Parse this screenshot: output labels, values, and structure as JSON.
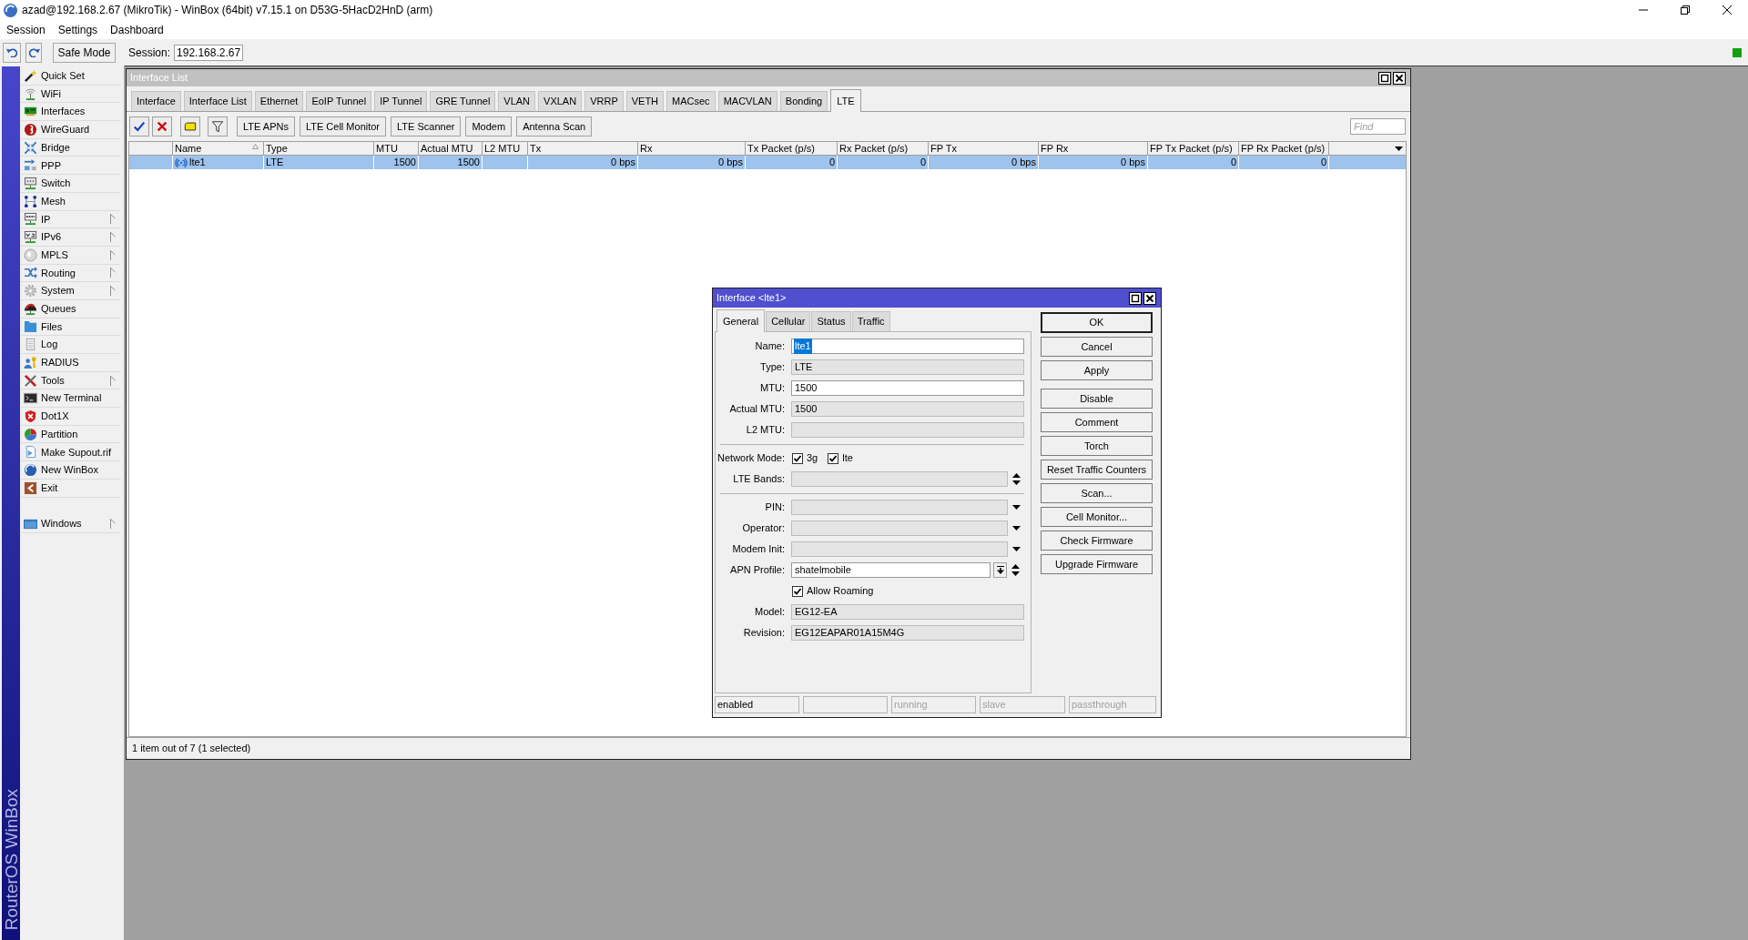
{
  "window": {
    "title": "azad@192.168.2.67 (MikroTik) - WinBox (64bit) v7.15.1 on D53G-5HacD2HnD (arm)"
  },
  "menu": [
    "Session",
    "Settings",
    "Dashboard"
  ],
  "toolbar": {
    "safe_mode": "Safe Mode",
    "session_label": "Session:",
    "session_value": "192.168.2.67"
  },
  "sidebar": {
    "brand": "RouterOS WinBox",
    "items": [
      {
        "label": "Quick Set",
        "submenu": false
      },
      {
        "label": "WiFi",
        "submenu": false
      },
      {
        "label": "Interfaces",
        "submenu": false
      },
      {
        "label": "WireGuard",
        "submenu": false
      },
      {
        "label": "Bridge",
        "submenu": false
      },
      {
        "label": "PPP",
        "submenu": false
      },
      {
        "label": "Switch",
        "submenu": false
      },
      {
        "label": "Mesh",
        "submenu": false
      },
      {
        "label": "IP",
        "submenu": true
      },
      {
        "label": "IPv6",
        "submenu": true
      },
      {
        "label": "MPLS",
        "submenu": true
      },
      {
        "label": "Routing",
        "submenu": true
      },
      {
        "label": "System",
        "submenu": true
      },
      {
        "label": "Queues",
        "submenu": false
      },
      {
        "label": "Files",
        "submenu": false
      },
      {
        "label": "Log",
        "submenu": false
      },
      {
        "label": "RADIUS",
        "submenu": false
      },
      {
        "label": "Tools",
        "submenu": true
      },
      {
        "label": "New Terminal",
        "submenu": false
      },
      {
        "label": "Dot1X",
        "submenu": false
      },
      {
        "label": "Partition",
        "submenu": false
      },
      {
        "label": "Make Supout.rif",
        "submenu": false
      },
      {
        "label": "New WinBox",
        "submenu": false
      },
      {
        "label": "Exit",
        "submenu": false
      }
    ],
    "footer_items": [
      {
        "label": "Windows",
        "submenu": true
      }
    ]
  },
  "interface_list": {
    "title": "Interface List",
    "active": false,
    "tabs": [
      {
        "label": "Interface",
        "selected": false
      },
      {
        "label": "Interface List",
        "selected": false
      },
      {
        "label": "Ethernet",
        "selected": false
      },
      {
        "label": "EoIP Tunnel",
        "selected": false
      },
      {
        "label": "IP Tunnel",
        "selected": false
      },
      {
        "label": "GRE Tunnel",
        "selected": false
      },
      {
        "label": "VLAN",
        "selected": false
      },
      {
        "label": "VXLAN",
        "selected": false
      },
      {
        "label": "VRRP",
        "selected": false
      },
      {
        "label": "VETH",
        "selected": false
      },
      {
        "label": "MACsec",
        "selected": false
      },
      {
        "label": "MACVLAN",
        "selected": false
      },
      {
        "label": "Bonding",
        "selected": false
      },
      {
        "label": "LTE",
        "selected": true
      }
    ],
    "toolbar_buttons": [
      "LTE APNs",
      "LTE Cell Monitor",
      "LTE Scanner",
      "Modem",
      "Antenna Scan"
    ],
    "find": {
      "placeholder": "Find"
    },
    "table": {
      "columns": [
        {
          "label": "Name",
          "sorted": true
        },
        {
          "label": "Type",
          "sorted": false
        },
        {
          "label": "MTU",
          "sorted": false
        },
        {
          "label": "Actual MTU",
          "sorted": false
        },
        {
          "label": "L2 MTU",
          "sorted": false
        },
        {
          "label": "Tx",
          "sorted": false
        },
        {
          "label": "Rx",
          "sorted": false
        },
        {
          "label": "Tx Packet (p/s)",
          "sorted": false
        },
        {
          "label": "Rx Packet (p/s)",
          "sorted": false
        },
        {
          "label": "FP Tx",
          "sorted": false
        },
        {
          "label": "FP Rx",
          "sorted": false
        },
        {
          "label": "FP Tx Packet (p/s)",
          "sorted": false
        },
        {
          "label": "FP Rx Packet (p/s)",
          "sorted": false
        }
      ],
      "rows": [
        {
          "selected": true,
          "name": "lte1",
          "type": "LTE",
          "mtu": "1500",
          "actual_mtu": "1500",
          "tx": "0 bps",
          "rx": "0 bps",
          "tx_packet": "0",
          "rx_packet": "0",
          "fp_tx": "0 bps",
          "fp_rx": "0 bps",
          "fp_tx_packet": "0",
          "fp_rx_packet": "0"
        }
      ]
    },
    "status_bar": "1 item out of 7 (1 selected)"
  },
  "interface_dialog": {
    "title": "Interface <lte1>",
    "active": true,
    "tabs": [
      {
        "label": "General",
        "selected": true
      },
      {
        "label": "Cellular",
        "selected": false
      },
      {
        "label": "Status",
        "selected": false
      },
      {
        "label": "Traffic",
        "selected": false
      }
    ],
    "fields": [
      {
        "kind": "text",
        "label": "Name:",
        "value": "lte1",
        "editable": true,
        "value_selected": true
      },
      {
        "kind": "text",
        "label": "Type:",
        "value": "LTE",
        "editable": false
      },
      {
        "kind": "text",
        "label": "MTU:",
        "value": "1500",
        "editable": true
      },
      {
        "kind": "text",
        "label": "Actual MTU:",
        "value": "1500",
        "editable": false
      },
      {
        "kind": "text",
        "label": "L2 MTU:",
        "editable": false
      },
      {
        "kind": "separator"
      },
      {
        "kind": "checks",
        "label": "Network Mode:",
        "options": [
          {
            "label": "3g",
            "checked": true
          },
          {
            "label": "lte",
            "checked": true
          }
        ]
      },
      {
        "kind": "list",
        "label": "LTE Bands:",
        "editable": false
      },
      {
        "kind": "separator"
      },
      {
        "kind": "dropdown",
        "label": "PIN:",
        "editable": false
      },
      {
        "kind": "dropdown",
        "label": "Operator:",
        "editable": false
      },
      {
        "kind": "dropdown",
        "label": "Modem Init:",
        "editable": false
      },
      {
        "kind": "combo",
        "label": "APN Profile:",
        "value": "shatelmobile",
        "editable": true
      },
      {
        "kind": "checkbox",
        "label": "Allow Roaming",
        "checked": true
      },
      {
        "kind": "text",
        "label": "Model:",
        "value": "EG12-EA",
        "editable": false
      },
      {
        "kind": "text",
        "label": "Revision:",
        "value": "EG12EAPAR01A15M4G",
        "editable": false
      }
    ],
    "button_groups": [
      [
        {
          "label": "OK",
          "default": true
        },
        {
          "label": "Cancel",
          "default": false
        },
        {
          "label": "Apply",
          "default": false
        }
      ],
      [
        {
          "label": "Disable",
          "default": false
        },
        {
          "label": "Comment",
          "default": false
        },
        {
          "label": "Torch",
          "default": false
        },
        {
          "label": "Reset Traffic Counters",
          "default": false
        },
        {
          "label": "Scan...",
          "default": false
        },
        {
          "label": "Cell Monitor...",
          "default": false
        },
        {
          "label": "Check Firmware",
          "default": false
        },
        {
          "label": "Upgrade Firmware",
          "default": false
        }
      ]
    ],
    "status_bar": [
      {
        "text": "enabled",
        "active": true
      },
      {
        "text": "running",
        "active": false
      },
      {
        "text": "slave",
        "active": false
      },
      {
        "text": "passthrough",
        "active": false
      }
    ]
  }
}
